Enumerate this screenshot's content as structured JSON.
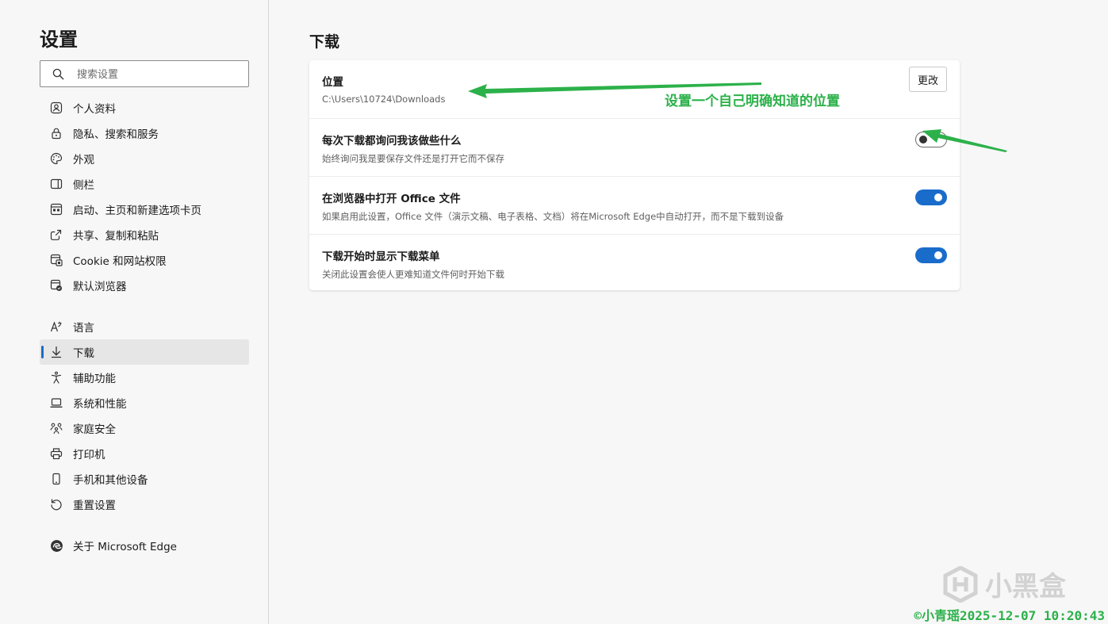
{
  "sidebar": {
    "title": "设置",
    "search_placeholder": "搜索设置",
    "items": [
      {
        "label": "个人资料",
        "icon": "profile-icon"
      },
      {
        "label": "隐私、搜索和服务",
        "icon": "lock-icon"
      },
      {
        "label": "外观",
        "icon": "palette-icon"
      },
      {
        "label": "侧栏",
        "icon": "sidebar-icon"
      },
      {
        "label": "启动、主页和新建选项卡页",
        "icon": "start-page-icon"
      },
      {
        "label": "共享、复制和粘贴",
        "icon": "share-icon"
      },
      {
        "label": "Cookie 和网站权限",
        "icon": "site-permissions-icon"
      },
      {
        "label": "默认浏览器",
        "icon": "default-browser-icon"
      },
      {
        "label": "语言",
        "icon": "language-icon"
      },
      {
        "label": "下载",
        "icon": "download-icon",
        "active": true
      },
      {
        "label": "辅助功能",
        "icon": "accessibility-icon"
      },
      {
        "label": "系统和性能",
        "icon": "laptop-icon"
      },
      {
        "label": "家庭安全",
        "icon": "family-icon"
      },
      {
        "label": "打印机",
        "icon": "printer-icon"
      },
      {
        "label": "手机和其他设备",
        "icon": "phone-icon"
      },
      {
        "label": "重置设置",
        "icon": "reset-icon"
      },
      {
        "label": "关于 Microsoft Edge",
        "icon": "edge-logo-icon"
      }
    ]
  },
  "main": {
    "title": "下载",
    "rows": [
      {
        "title": "位置",
        "desc": "C:\\Users\\10724\\Downloads",
        "button": "更改"
      },
      {
        "title": "每次下载都询问我该做些什么",
        "desc": "始终询问我是要保存文件还是打开它而不保存",
        "toggle": "off"
      },
      {
        "title": "在浏览器中打开 Office 文件",
        "desc": "如果启用此设置，Office 文件（演示文稿、电子表格、文档）将在Microsoft Edge中自动打开，而不是下载到设备",
        "toggle": "on"
      },
      {
        "title": "下载开始时显示下载菜单",
        "desc": "关闭此设置会使人更难知道文件何时开始下载",
        "toggle": "on"
      }
    ]
  },
  "annotation": {
    "text": "设置一个自己明确知道的位置",
    "color": "#2cb14a"
  },
  "watermark": {
    "text": "小黑盒"
  },
  "footer": {
    "stamp": "©小青瑶2025-12-07 10:20:43"
  },
  "colors": {
    "accent": "#1a6ccb",
    "annotation": "#2cb14a"
  }
}
